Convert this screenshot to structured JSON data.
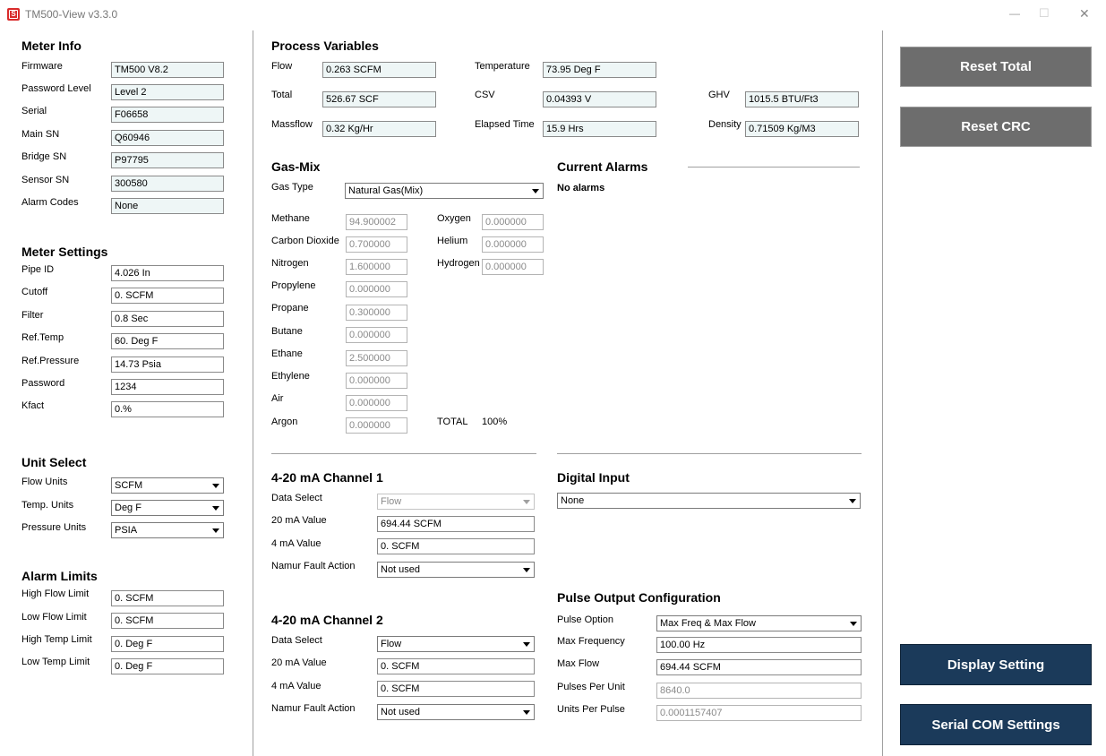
{
  "window": {
    "title": "TM500-View v3.3.0",
    "minimize": "—",
    "maximize": "☐",
    "close": "✕"
  },
  "meter_info": {
    "title": "Meter Info",
    "rows": [
      {
        "label": "Firmware",
        "value": "TM500 V8.2"
      },
      {
        "label": "Password Level",
        "value": "Level 2"
      },
      {
        "label": "Serial",
        "value": "F06658"
      },
      {
        "label": "Main SN",
        "value": "Q60946"
      },
      {
        "label": "Bridge SN",
        "value": "P97795"
      },
      {
        "label": "Sensor SN",
        "value": "300580"
      },
      {
        "label": "Alarm Codes",
        "value": "None"
      }
    ]
  },
  "meter_settings": {
    "title": "Meter Settings",
    "rows": [
      {
        "label": "Pipe ID",
        "value": "4.026 In"
      },
      {
        "label": "Cutoff",
        "value": "0. SCFM"
      },
      {
        "label": "Filter",
        "value": "0.8 Sec"
      },
      {
        "label": "Ref.Temp",
        "value": "60. Deg F"
      },
      {
        "label": "Ref.Pressure",
        "value": "14.73 Psia"
      },
      {
        "label": "Password",
        "value": "1234"
      },
      {
        "label": "Kfact",
        "value": "0.%"
      }
    ]
  },
  "unit_select": {
    "title": "Unit Select",
    "rows": [
      {
        "label": "Flow Units",
        "value": "SCFM"
      },
      {
        "label": "Temp. Units",
        "value": "Deg F"
      },
      {
        "label": "Pressure Units",
        "value": "PSIA"
      }
    ]
  },
  "alarm_limits": {
    "title": "Alarm Limits",
    "rows": [
      {
        "label": "High Flow Limit",
        "value": "0. SCFM"
      },
      {
        "label": "Low Flow Limit",
        "value": "0. SCFM"
      },
      {
        "label": "High Temp Limit",
        "value": "0. Deg F"
      },
      {
        "label": "Low Temp Limit",
        "value": "0. Deg F"
      }
    ]
  },
  "process_variables": {
    "title": "Process Variables",
    "flow": {
      "label": "Flow",
      "value": "0.263 SCFM"
    },
    "temperature": {
      "label": "Temperature",
      "value": "73.95 Deg F"
    },
    "total": {
      "label": "Total",
      "value": "526.67 SCF"
    },
    "csv": {
      "label": "CSV",
      "value": "0.04393 V"
    },
    "ghv": {
      "label": "GHV",
      "value": "1015.5 BTU/Ft3"
    },
    "massflow": {
      "label": "Massflow",
      "value": "0.32 Kg/Hr"
    },
    "elapsed": {
      "label": "Elapsed Time",
      "value": "15.9  Hrs"
    },
    "density": {
      "label": "Density",
      "value": "0.71509 Kg/M3"
    }
  },
  "gas_mix": {
    "title": "Gas-Mix",
    "gas_type_label": "Gas Type",
    "gas_type_value": "Natural Gas(Mix)",
    "left": [
      {
        "label": "Methane",
        "value": "94.900002"
      },
      {
        "label": "Carbon Dioxide",
        "value": "0.700000"
      },
      {
        "label": "Nitrogen",
        "value": "1.600000"
      },
      {
        "label": "Propylene",
        "value": "0.000000"
      },
      {
        "label": "Propane",
        "value": "0.300000"
      },
      {
        "label": "Butane",
        "value": "0.000000"
      },
      {
        "label": "Ethane",
        "value": "2.500000"
      },
      {
        "label": "Ethylene",
        "value": "0.000000"
      },
      {
        "label": "Air",
        "value": "0.000000"
      },
      {
        "label": "Argon",
        "value": "0.000000"
      }
    ],
    "right": [
      {
        "label": "Oxygen",
        "value": "0.000000"
      },
      {
        "label": "Helium",
        "value": "0.000000"
      },
      {
        "label": "Hydrogen",
        "value": "0.000000"
      }
    ],
    "total_label": "TOTAL",
    "total_value": "100%"
  },
  "current_alarms": {
    "title": "Current Alarms",
    "text": "No alarms"
  },
  "channel1": {
    "title": "4-20 mA Channel 1",
    "data_select_label": "Data Select",
    "data_select_value": "Flow",
    "ma20_label": "20 mA Value",
    "ma20_value": "694.44 SCFM",
    "ma4_label": "4 mA Value",
    "ma4_value": "0. SCFM",
    "namur_label": "Namur Fault Action",
    "namur_value": "Not used"
  },
  "channel2": {
    "title": "4-20 mA Channel 2",
    "data_select_label": "Data Select",
    "data_select_value": "Flow",
    "ma20_label": "20 mA Value",
    "ma20_value": "0. SCFM",
    "ma4_label": "4 mA Value",
    "ma4_value": "0. SCFM",
    "namur_label": "Namur Fault Action",
    "namur_value": "Not used"
  },
  "digital_input": {
    "title": "Digital Input",
    "value": "None"
  },
  "pulse_output": {
    "title": "Pulse Output Configuration",
    "option_label": "Pulse Option",
    "option_value": "Max Freq & Max Flow",
    "max_freq_label": "Max Frequency",
    "max_freq_value": "100.00 Hz",
    "max_flow_label": "Max Flow",
    "max_flow_value": "694.44 SCFM",
    "ppu_label": "Pulses Per Unit",
    "ppu_value": "8640.0",
    "upp_label": "Units Per Pulse",
    "upp_value": "0.0001157407"
  },
  "buttons": {
    "reset_total": "Reset Total",
    "reset_crc": "Reset CRC",
    "display_setting": "Display Setting",
    "serial_com": "Serial COM Settings"
  },
  "colors": {
    "gray_button": "#6d6d6d",
    "navy_button": "#1b3a5a",
    "readonly_field": "#eef6f6",
    "logo": "#d92b2b"
  }
}
